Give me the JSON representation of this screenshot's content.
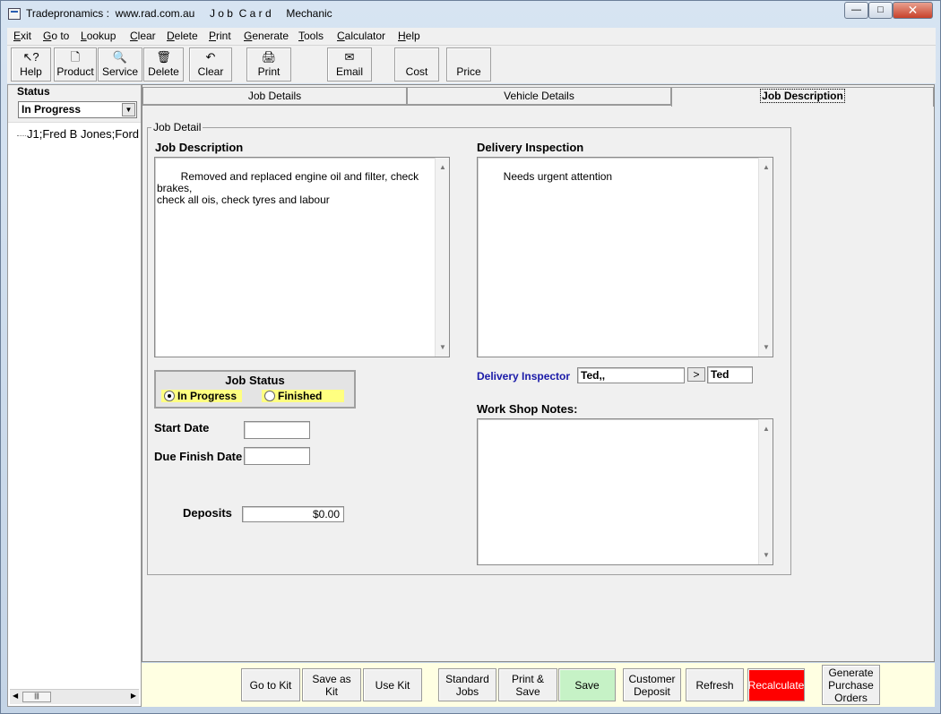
{
  "window": {
    "title": "Tradepronamics :  www.rad.com.au     J o b  C a r d     Mechanic",
    "minimize_glyph": "—",
    "maximize_glyph": "□",
    "close_glyph": "✕"
  },
  "menu": [
    {
      "u": "E",
      "rest": "xit"
    },
    {
      "u": "G",
      "rest": "o to"
    },
    {
      "u": "L",
      "rest": "ookup"
    },
    {
      "u": "C",
      "rest": "lear"
    },
    {
      "u": "D",
      "rest": "elete"
    },
    {
      "u": "P",
      "rest": "rint"
    },
    {
      "u": "G",
      "rest": "enerate"
    },
    {
      "u": "T",
      "rest": "ools"
    },
    {
      "u": "C",
      "rest": "alculator"
    },
    {
      "u": "H",
      "rest": "elp"
    }
  ],
  "toolbar": [
    {
      "label": "Help",
      "icon": "help-pointer-icon",
      "glyph": "↖?"
    },
    {
      "label": "Product",
      "icon": "document-icon",
      "glyph": "🗋"
    },
    {
      "label": "Service",
      "icon": "magnifier-icon",
      "glyph": "🔍"
    },
    {
      "label": "Delete",
      "icon": "trash-icon",
      "glyph": "🗑"
    },
    {
      "label": "Clear",
      "icon": "undo-icon",
      "glyph": "↶"
    },
    {
      "label": "Print",
      "icon": "printer-icon",
      "glyph": "🖨"
    },
    {
      "label": "Email",
      "icon": "email-icon",
      "glyph": "✉"
    },
    {
      "label": "Cost",
      "icon": "",
      "glyph": ""
    },
    {
      "label": "Price",
      "icon": "",
      "glyph": ""
    }
  ],
  "left": {
    "status_label": "Status",
    "status_value": "In Progress",
    "tree_item": "J1;Fred B Jones;Ford",
    "scroll_left": "◀",
    "scroll_thumb": "|||",
    "scroll_right": "▶",
    "dropdown_arrow": "▼"
  },
  "tabs": {
    "job_details": "Job Details",
    "vehicle_details": "Vehicle Details",
    "job_description": "Job Description"
  },
  "job_detail": {
    "group_label": "Job Detail",
    "job_description_heading": "Job Description",
    "job_description_text": "Removed and replaced engine oil and filter, check brakes,\ncheck all ois, check tyres and labour",
    "delivery_inspection_heading": "Delivery Inspection",
    "delivery_inspection_text": "Needs urgent attention",
    "job_status_title": "Job Status",
    "status_in_progress": "In Progress",
    "status_finished": "Finished",
    "start_date_label": "Start Date",
    "start_date_value": "",
    "due_finish_date_label": "Due Finish Date",
    "due_finish_date_value": "",
    "deposits_label": "Deposits",
    "deposits_value": "$0.00",
    "delivery_inspector_label": "Delivery Inspector",
    "delivery_inspector_value": "Ted,,",
    "inspector_button": ">",
    "inspector_short": "Ted",
    "workshop_notes_heading": "Work Shop Notes:",
    "workshop_notes_text": "",
    "scroll_up": "▲",
    "scroll_down": "▼"
  },
  "bottom_buttons": {
    "go_to_kit": "Go to Kit",
    "save_as_kit": "Save as Kit",
    "use_kit": "Use Kit",
    "standard_jobs": "Standard\nJobs",
    "print_save": "Print & Save",
    "save": "Save",
    "customer_deposit": "Customer\nDeposit",
    "refresh": "Refresh",
    "recalculate": "Recalculate",
    "generate_purchase_orders": "Generate\nPurchase\nOrders"
  },
  "colors": {
    "save_button": "#c6f2c6",
    "recalculate_button": "#ff0000",
    "radio_highlight": "#ffff80",
    "inspector_label": "#1a1aa8",
    "bottom_bar": "#ffffe2"
  }
}
